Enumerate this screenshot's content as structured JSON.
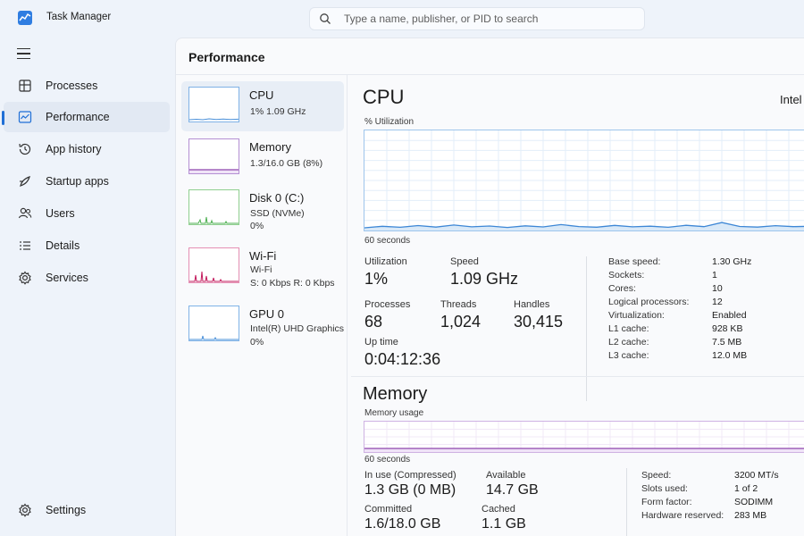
{
  "window": {
    "title": "Task Manager"
  },
  "search": {
    "placeholder": "Type a name, publisher, or PID to search"
  },
  "nav": {
    "items": [
      {
        "label": "Processes",
        "icon": "processes-icon"
      },
      {
        "label": "Performance",
        "icon": "performance-icon",
        "active": true
      },
      {
        "label": "App history",
        "icon": "history-icon"
      },
      {
        "label": "Startup apps",
        "icon": "startup-icon"
      },
      {
        "label": "Users",
        "icon": "users-icon"
      },
      {
        "label": "Details",
        "icon": "details-icon"
      },
      {
        "label": "Services",
        "icon": "services-icon"
      }
    ],
    "settings_label": "Settings"
  },
  "page": {
    "title": "Performance"
  },
  "devices": [
    {
      "name": "CPU",
      "line1": "1%  1.09 GHz",
      "line2": "",
      "color": "#4a90d9",
      "active": true
    },
    {
      "name": "Memory",
      "line1": "1.3/16.0 GB (8%)",
      "line2": "",
      "color": "#8e44ad"
    },
    {
      "name": "Disk 0 (C:)",
      "line1": "SSD (NVMe)",
      "line2": "0%",
      "color": "#4caf50"
    },
    {
      "name": "Wi-Fi",
      "line1": "Wi-Fi",
      "line2": "S: 0 Kbps  R: 0 Kbps",
      "color": "#c2185b"
    },
    {
      "name": "GPU 0",
      "line1": "Intel(R) UHD Graphics",
      "line2": "0%",
      "color": "#4a90d9"
    }
  ],
  "cpu": {
    "title": "CPU",
    "model": "Intel",
    "graph_label": "% Utilization",
    "time_label": "60 seconds",
    "utilization": {
      "label": "Utilization",
      "value": "1%"
    },
    "speed": {
      "label": "Speed",
      "value": "1.09 GHz"
    },
    "processes": {
      "label": "Processes",
      "value": "68"
    },
    "threads": {
      "label": "Threads",
      "value": "1,024"
    },
    "handles": {
      "label": "Handles",
      "value": "30,415"
    },
    "uptime": {
      "label": "Up time",
      "value": "0:04:12:36"
    },
    "specs": [
      {
        "key": "Base speed:",
        "value": "1.30 GHz"
      },
      {
        "key": "Sockets:",
        "value": "1"
      },
      {
        "key": "Cores:",
        "value": "10"
      },
      {
        "key": "Logical processors:",
        "value": "12"
      },
      {
        "key": "Virtualization:",
        "value": "Enabled"
      },
      {
        "key": "L1 cache:",
        "value": "928 KB"
      },
      {
        "key": "L2 cache:",
        "value": "7.5 MB"
      },
      {
        "key": "L3 cache:",
        "value": "12.0 MB"
      }
    ],
    "colors": {
      "line": "#3d87d6",
      "fill": "#d9e9f8",
      "border": "#9ec5ec",
      "grid": "#e3eef9"
    }
  },
  "memory": {
    "title": "Memory",
    "graph_label": "Memory usage",
    "time_label": "60 seconds",
    "in_use": {
      "label": "In use (Compressed)",
      "value": "1.3 GB (0 MB)"
    },
    "available": {
      "label": "Available",
      "value": "14.7 GB"
    },
    "committed": {
      "label": "Committed",
      "value": "1.6/18.0 GB"
    },
    "cached": {
      "label": "Cached",
      "value": "1.1 GB"
    },
    "specs": [
      {
        "key": "Speed:",
        "value": "3200 MT/s"
      },
      {
        "key": "Slots used:",
        "value": "1 of 2"
      },
      {
        "key": "Form factor:",
        "value": "SODIMM"
      },
      {
        "key": "Hardware reserved:",
        "value": "283 MB"
      }
    ],
    "colors": {
      "line": "#8e44ad",
      "fill": "#efe3f7",
      "border": "#cfb2e3",
      "grid": "#f1e8f7"
    }
  }
}
